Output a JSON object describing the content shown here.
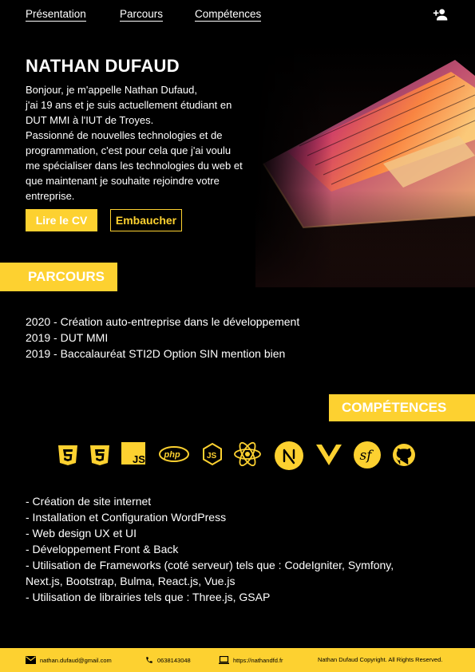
{
  "nav": {
    "items": [
      {
        "label": "Présentation"
      },
      {
        "label": "Parcours"
      },
      {
        "label": "Compétences"
      }
    ],
    "user_icon": "person-add-icon"
  },
  "hero": {
    "name": "NATHAN DUFAUD",
    "intro_lines": [
      "Bonjour, je m'appelle Nathan Dufaud,",
      "j'ai 19 ans et je suis actuellement étudiant en",
      "DUT MMI à l'IUT de Troyes.",
      "Passionné de nouvelles technologies et de",
      "programmation, c'est pour cela que j'ai voulu",
      "me spécialiser dans les technologies du web et",
      "que maintenant je souhaite rejoindre votre",
      "entreprise."
    ],
    "cv_button": "Lire le CV",
    "hire_button": "Embaucher",
    "image": "laptop-photo"
  },
  "parcours": {
    "title": "PARCOURS",
    "items": [
      "2020 - Création auto-entreprise dans le développement",
      "2019 - DUT MMI",
      "2019 - Baccalauréat STI2D Option SIN mention bien"
    ]
  },
  "competences": {
    "title": "COMPÉTENCES",
    "icons": [
      "html5-icon",
      "css3-icon",
      "javascript-icon",
      "php-icon",
      "nodejs-icon",
      "react-icon",
      "nextjs-icon",
      "vuejs-icon",
      "symfony-icon",
      "github-icon"
    ],
    "items": [
      "- Création de site internet",
      "- Installation et Configuration WordPress",
      "- Web design UX et UI",
      "- Développement Front & Back",
      "- Utilisation de Frameworks (coté serveur) tels que : CodeIgniter, Symfony,",
      "Next.js, Bootstrap, Bulma, React.js, Vue.js",
      "- Utilisation de librairies tels que : Three.js, GSAP"
    ]
  },
  "footer": {
    "email": "nathan.dufaud@gmail.com",
    "phone": "0638143048",
    "website": "https://nathandfd.fr",
    "copyright": "Nathan Dufaud Copyright. All Rights Reserved."
  },
  "colors": {
    "accent": "#FDD130",
    "background": "#000000",
    "text": "#FFFFFF"
  }
}
